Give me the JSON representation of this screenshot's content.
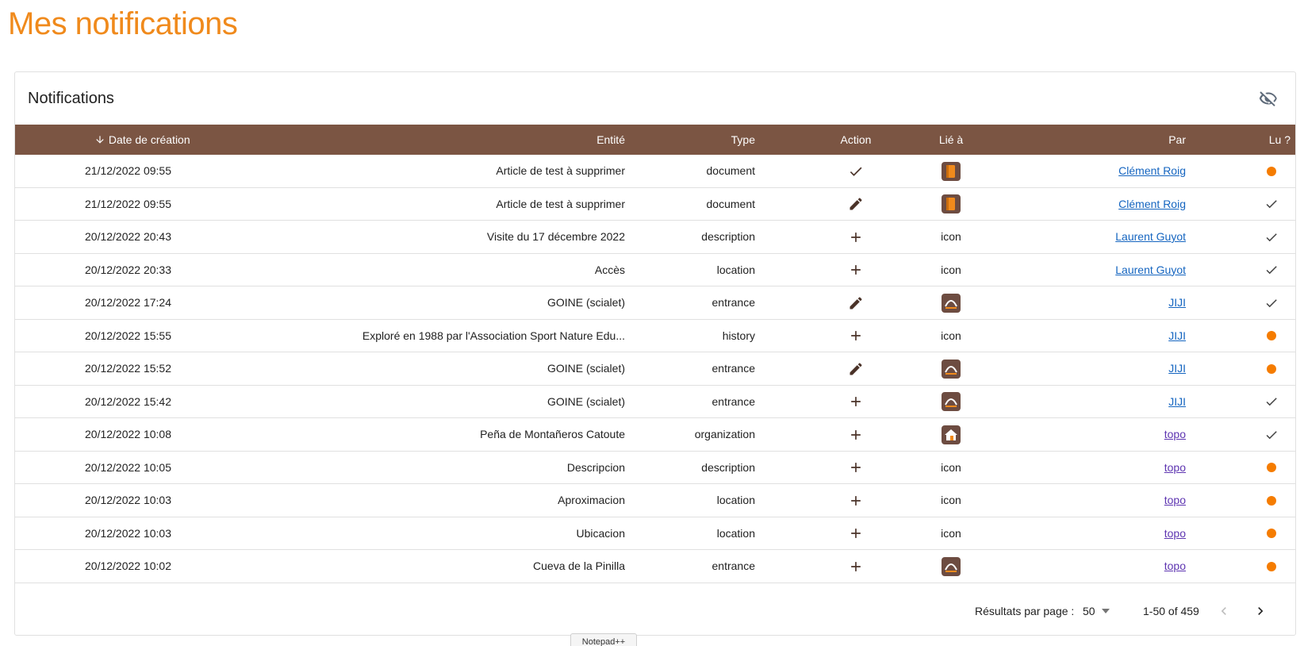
{
  "page": {
    "title": "Mes notifications"
  },
  "card": {
    "title": "Notifications",
    "toggle_icon": "eye-off-icon"
  },
  "columns": {
    "date": "Date de création",
    "entity": "Entité",
    "type": "Type",
    "action": "Action",
    "linked": "Lié à",
    "by": "Par",
    "read": "Lu ?"
  },
  "sort_icon": "arrow-down-icon",
  "rows": [
    {
      "date": "21/12/2022 09:55",
      "entity": "Article de test à supprimer",
      "type": "document",
      "action": "check",
      "linked": "document-icon",
      "by": "Clément Roig",
      "read": "unread-dot"
    },
    {
      "date": "21/12/2022 09:55",
      "entity": "Article de test à supprimer",
      "type": "document",
      "action": "edit",
      "linked": "document-icon",
      "by": "Clément Roig",
      "read": "check"
    },
    {
      "date": "20/12/2022 20:43",
      "entity": "Visite du 17 décembre 2022",
      "type": "description",
      "action": "add",
      "linked": "icon",
      "by": "Laurent Guyot",
      "read": "check"
    },
    {
      "date": "20/12/2022 20:33",
      "entity": "Accès",
      "type": "location",
      "action": "add",
      "linked": "icon",
      "by": "Laurent Guyot",
      "read": "check"
    },
    {
      "date": "20/12/2022 17:24",
      "entity": "GOINE (scialet)",
      "type": "entrance",
      "action": "edit",
      "linked": "entrance-icon",
      "by": "JIJI",
      "read": "check"
    },
    {
      "date": "20/12/2022 15:55",
      "entity": "Exploré en 1988 par l'Association Sport Nature Edu...",
      "type": "history",
      "action": "add",
      "linked": "icon",
      "by": "JIJI",
      "read": "unread-dot"
    },
    {
      "date": "20/12/2022 15:52",
      "entity": "GOINE (scialet)",
      "type": "entrance",
      "action": "edit",
      "linked": "entrance-icon",
      "by": "JIJI",
      "read": "unread-dot"
    },
    {
      "date": "20/12/2022 15:42",
      "entity": "GOINE (scialet)",
      "type": "entrance",
      "action": "add",
      "linked": "entrance-icon",
      "by": "JIJI",
      "read": "check"
    },
    {
      "date": "20/12/2022 10:08",
      "entity": "Peña de Montañeros Catoute",
      "type": "organization",
      "action": "add",
      "linked": "organization-icon",
      "by": "topo",
      "read": "check"
    },
    {
      "date": "20/12/2022 10:05",
      "entity": "Descripcion",
      "type": "description",
      "action": "add",
      "linked": "icon",
      "by": "topo",
      "read": "unread-dot"
    },
    {
      "date": "20/12/2022 10:03",
      "entity": "Aproximacion",
      "type": "location",
      "action": "add",
      "linked": "icon",
      "by": "topo",
      "read": "unread-dot"
    },
    {
      "date": "20/12/2022 10:03",
      "entity": "Ubicacion",
      "type": "location",
      "action": "add",
      "linked": "icon",
      "by": "topo",
      "read": "unread-dot"
    },
    {
      "date": "20/12/2022 10:02",
      "entity": "Cueva de la Pinilla",
      "type": "entrance",
      "action": "add",
      "linked": "entrance-icon",
      "by": "topo",
      "read": "unread-dot"
    }
  ],
  "pagination": {
    "rows_per_page_label": "Résultats par page :",
    "rows_per_page_value": "50",
    "range": "1-50 of 459",
    "prev_icon": "chevron-left-icon",
    "next_icon": "chevron-right-icon"
  },
  "tooltip": {
    "text": "Notepad++"
  },
  "colors": {
    "accent": "#f08a1c",
    "header_bg": "#7b5543",
    "icon_brown": "#6d4c41",
    "unread": "#f57c00",
    "link": "#1565c0"
  }
}
